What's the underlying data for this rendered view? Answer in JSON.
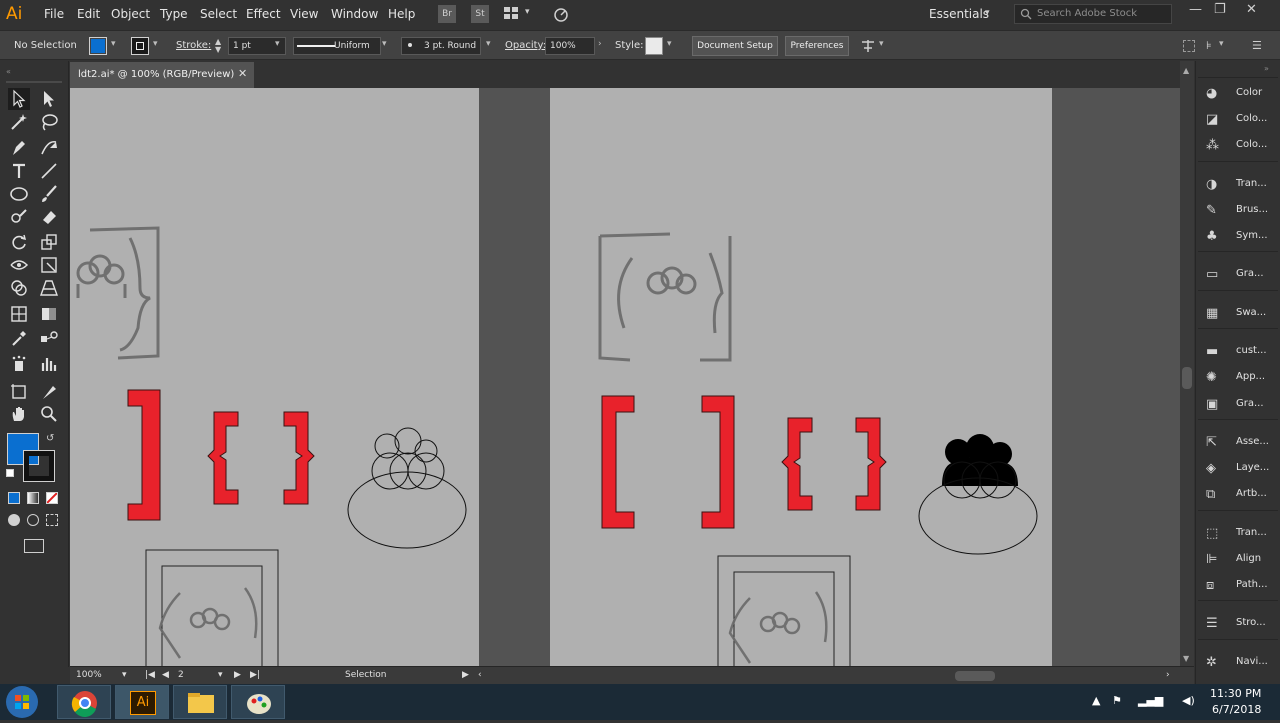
{
  "app": {
    "logo": "Ai",
    "menus": [
      "File",
      "Edit",
      "Object",
      "Type",
      "Select",
      "Effect",
      "View",
      "Window",
      "Help"
    ],
    "bridge_label": "Br",
    "stock_label": "St",
    "workspace": "Essentials",
    "search_placeholder": "Search Adobe Stock"
  },
  "control_bar": {
    "selection": "No Selection",
    "stroke_label": "Stroke:",
    "stroke_weight": "1 pt",
    "stroke_profile": "Uniform",
    "brush": "3 pt. Round",
    "opacity_label": "Opacity:",
    "opacity_value": "100%",
    "style_label": "Style:",
    "document_setup": "Document Setup",
    "preferences": "Preferences",
    "fill_color": "#0a6fd0"
  },
  "document": {
    "tab_title": "ldt2.ai* @ 100% (RGB/Preview)"
  },
  "status_bar": {
    "zoom": "100%",
    "artboard_number": "2",
    "tool_name": "Selection"
  },
  "panels": [
    {
      "label": "Color",
      "icon": "palette-icon"
    },
    {
      "label": "Colo...",
      "icon": "color-guide-icon"
    },
    {
      "label": "Colo...",
      "icon": "color-themes-icon"
    },
    {
      "label": "Tran...",
      "icon": "transparency-icon"
    },
    {
      "label": "Brus...",
      "icon": "brush-icon"
    },
    {
      "label": "Sym...",
      "icon": "symbol-icon"
    },
    {
      "label": "Gra...",
      "icon": "gradient-icon"
    },
    {
      "label": "Swa...",
      "icon": "swatches-icon"
    },
    {
      "label": "cust...",
      "icon": "library-icon"
    },
    {
      "label": "App...",
      "icon": "appearance-icon"
    },
    {
      "label": "Gra...",
      "icon": "graphic-styles-icon"
    },
    {
      "label": "Asse...",
      "icon": "asset-export-icon"
    },
    {
      "label": "Laye...",
      "icon": "layers-icon"
    },
    {
      "label": "Artb...",
      "icon": "artboards-icon"
    },
    {
      "label": "Tran...",
      "icon": "transform-icon"
    },
    {
      "label": "Align",
      "icon": "align-icon"
    },
    {
      "label": "Path...",
      "icon": "pathfinder-icon"
    },
    {
      "label": "Stro...",
      "icon": "stroke-icon"
    },
    {
      "label": "Navi...",
      "icon": "navigator-icon"
    }
  ],
  "taskbar": {
    "time": "11:30 PM",
    "date": "6/7/2018",
    "apps": [
      "chrome-icon",
      "illustrator-icon",
      "file-explorer-icon",
      "paint-icon"
    ],
    "illustrator_label": "Ai"
  },
  "colors": {
    "accent_red": "#e8222b",
    "fill_blue": "#0a6fd0",
    "ui_dark": "#323232"
  }
}
